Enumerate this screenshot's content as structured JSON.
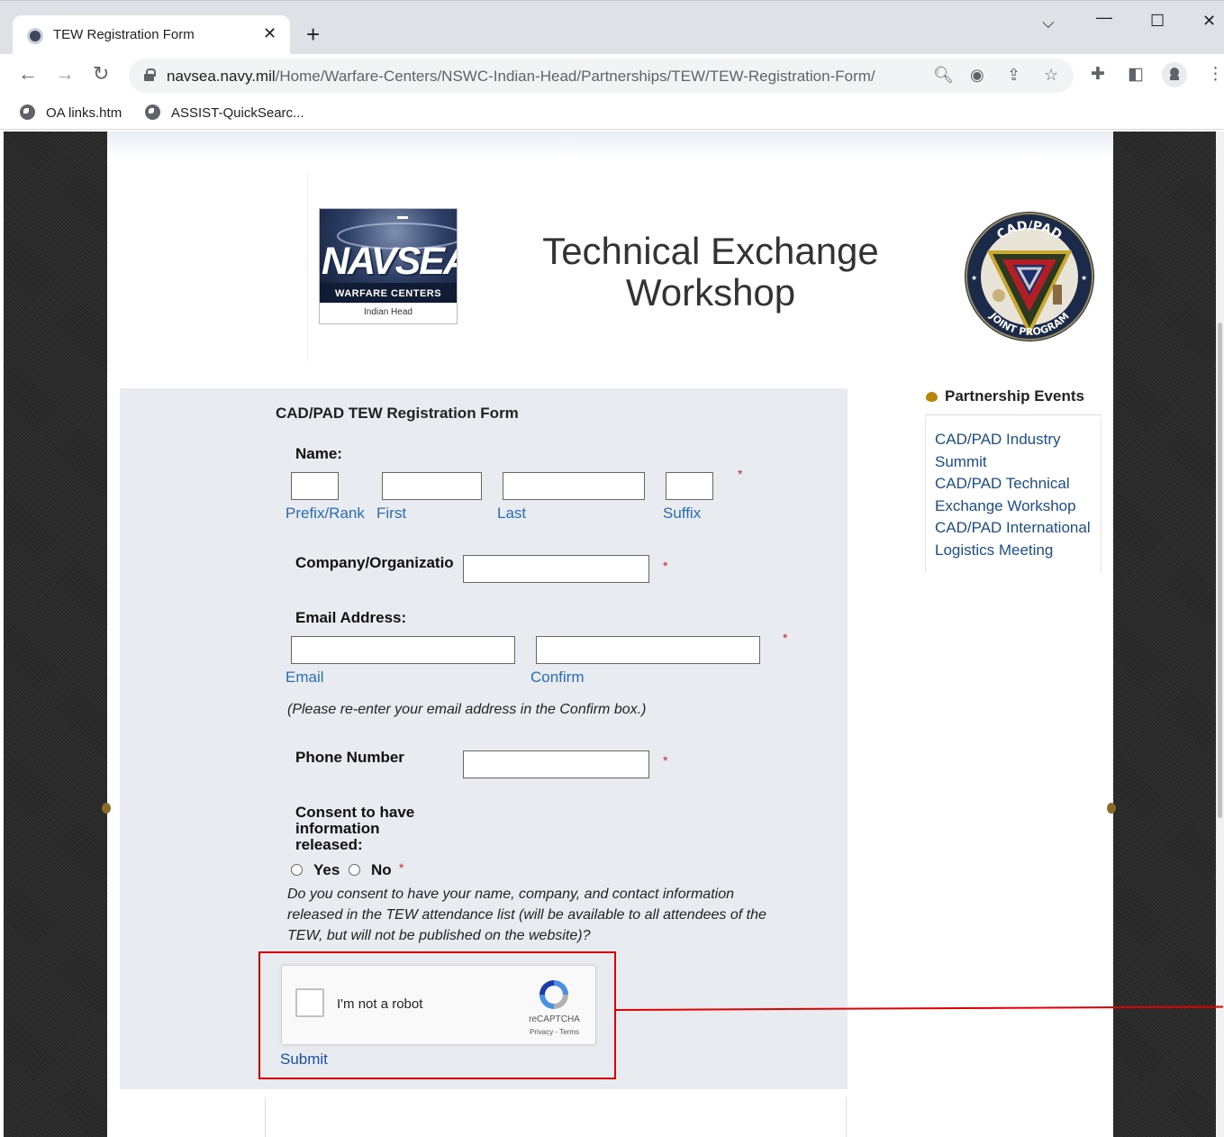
{
  "browser": {
    "tab_title": "TEW Registration Form",
    "tab_close": "✕",
    "new_tab": "+",
    "url_host": "navsea.navy.mil",
    "url_path": "/Home/Warfare-Centers/NSWC-Indian-Head/Partnerships/TEW/TEW-Registration-Form/",
    "bookmarks": [
      "OA links.htm",
      "ASSIST-QuickSearc..."
    ]
  },
  "header": {
    "logo_word": "NAVSEA",
    "logo_subtitle": "WARFARE CENTERS",
    "logo_location": "Indian Head",
    "title_line1": "Technical Exchange",
    "title_line2": "Workshop",
    "seal_text_top": "CAD/PAD",
    "seal_text_bottom": "JOINT PROGRAM"
  },
  "form": {
    "title": "CAD/PAD TEW Registration Form",
    "name_label": "Name:",
    "name_sublabels": [
      "Prefix/Rank",
      "First",
      "Last",
      "Suffix"
    ],
    "company_label": "Company/Organizatio",
    "email_label": "Email Address:",
    "email_sublabels": [
      "Email",
      "Confirm"
    ],
    "email_hint": "(Please re-enter your email address in the Confirm box.)",
    "phone_label": "Phone Number",
    "consent_label_lines": [
      "Consent to have",
      "information",
      "released:"
    ],
    "consent_yes": "Yes",
    "consent_no": "No",
    "consent_question_lines": [
      "Do you consent to have your name, company, and contact information",
      "released in the TEW attendance list (will be available to all attendees of the",
      "TEW, but will not be published on the website)?"
    ],
    "required_mark": "*",
    "recaptcha_label": "I'm not a robot",
    "recaptcha_brand": "reCAPTCHA",
    "recaptcha_links": "Privacy - Terms",
    "submit_label": "Submit"
  },
  "sidebar": {
    "heading": "Partnership Events",
    "events": [
      "CAD/PAD Industry Summit",
      "CAD/PAD Technical Exchange Workshop",
      "CAD/PAD International Logistics Meeting"
    ],
    "event_lines": [
      "CAD/PAD Industry",
      "Summit",
      "CAD/PAD Technical",
      "Exchange Workshop",
      "CAD/PAD International",
      "Logistics Meeting"
    ]
  },
  "colors": {
    "link": "#2a6db0",
    "required": "#cc2222",
    "callout": "#e00000",
    "form_bg": "#e8ebf0"
  }
}
